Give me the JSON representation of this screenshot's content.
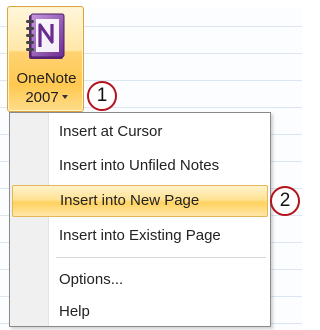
{
  "ribbon": {
    "onenote_button": {
      "label_line1": "OneNote",
      "label_line2": "2007",
      "icon": "onenote-notebook-icon"
    }
  },
  "callouts": [
    "1",
    "2"
  ],
  "menu": {
    "items": [
      {
        "label": "Insert at Cursor",
        "highlighted": false
      },
      {
        "label": "Insert into Unfiled Notes",
        "highlighted": false
      },
      {
        "label": "Insert into New Page",
        "highlighted": true
      },
      {
        "label": "Insert into Existing Page",
        "highlighted": false
      },
      {
        "label": "Options...",
        "highlighted": false
      },
      {
        "label": "Help",
        "highlighted": false
      }
    ]
  },
  "colors": {
    "highlight": "#ffd25f",
    "callout_border": "#b5121b",
    "onenote_purple": "#7b3f9b"
  }
}
